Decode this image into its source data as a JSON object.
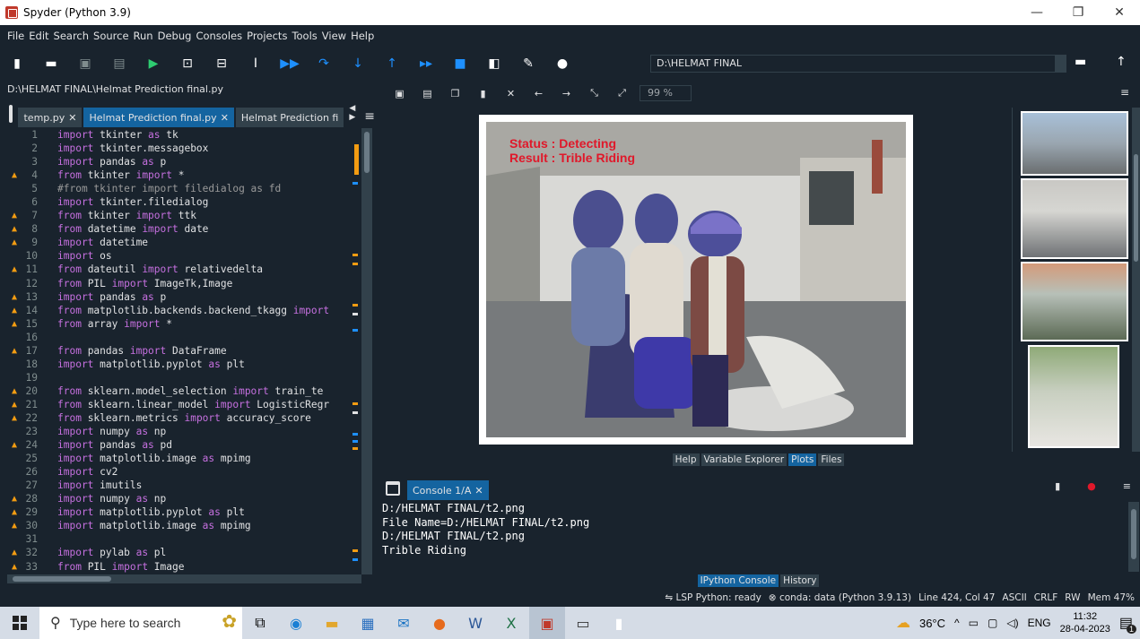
{
  "window": {
    "title": "Spyder (Python 3.9)"
  },
  "menu": [
    "File",
    "Edit",
    "Search",
    "Source",
    "Run",
    "Debug",
    "Consoles",
    "Projects",
    "Tools",
    "View",
    "Help"
  ],
  "toolbar": {
    "working_dir": "D:\\HELMAT FINAL"
  },
  "editor": {
    "file_path": "D:\\HELMAT FINAL\\Helmat Prediction final.py",
    "tabs": [
      {
        "label": "temp.py",
        "active": false
      },
      {
        "label": "Helmat Prediction final.py",
        "active": true
      },
      {
        "label": "Helmat Prediction fi",
        "active": false
      }
    ],
    "lines": [
      {
        "n": "1",
        "w": false,
        "t": "import tkinter as tk"
      },
      {
        "n": "2",
        "w": false,
        "t": "import tkinter.messagebox"
      },
      {
        "n": "3",
        "w": false,
        "t": "import pandas as p"
      },
      {
        "n": "4",
        "w": true,
        "t": "from tkinter import *"
      },
      {
        "n": "5",
        "w": false,
        "t": "#from tkinter import filedialog as fd"
      },
      {
        "n": "6",
        "w": false,
        "t": "import tkinter.filedialog"
      },
      {
        "n": "7",
        "w": true,
        "t": "from tkinter import ttk"
      },
      {
        "n": "8",
        "w": true,
        "t": "from datetime import date"
      },
      {
        "n": "9",
        "w": true,
        "t": "import datetime"
      },
      {
        "n": "10",
        "w": false,
        "t": "import os"
      },
      {
        "n": "11",
        "w": true,
        "t": "from dateutil import relativedelta"
      },
      {
        "n": "12",
        "w": false,
        "t": "from PIL import ImageTk,Image"
      },
      {
        "n": "13",
        "w": true,
        "t": "import pandas as p"
      },
      {
        "n": "14",
        "w": true,
        "t": "from matplotlib.backends.backend_tkagg import"
      },
      {
        "n": "15",
        "w": true,
        "t": "from array import *"
      },
      {
        "n": "16",
        "w": false,
        "t": ""
      },
      {
        "n": "17",
        "w": true,
        "t": "from pandas import DataFrame"
      },
      {
        "n": "18",
        "w": false,
        "t": "import matplotlib.pyplot as plt"
      },
      {
        "n": "19",
        "w": false,
        "t": ""
      },
      {
        "n": "20",
        "w": true,
        "t": "from sklearn.model_selection import train_te"
      },
      {
        "n": "21",
        "w": true,
        "t": "from sklearn.linear_model import LogisticRegr"
      },
      {
        "n": "22",
        "w": true,
        "t": "from sklearn.metrics import accuracy_score"
      },
      {
        "n": "23",
        "w": false,
        "t": "import numpy as np"
      },
      {
        "n": "24",
        "w": true,
        "t": "import pandas as pd"
      },
      {
        "n": "25",
        "w": false,
        "t": "import matplotlib.image as mpimg"
      },
      {
        "n": "26",
        "w": false,
        "t": "import cv2"
      },
      {
        "n": "27",
        "w": false,
        "t": "import imutils"
      },
      {
        "n": "28",
        "w": true,
        "t": "import numpy as np"
      },
      {
        "n": "29",
        "w": true,
        "t": "import matplotlib.pyplot as plt"
      },
      {
        "n": "30",
        "w": true,
        "t": "import matplotlib.image as mpimg"
      },
      {
        "n": "31",
        "w": false,
        "t": ""
      },
      {
        "n": "32",
        "w": true,
        "t": "import pylab as pl"
      },
      {
        "n": "33",
        "w": true,
        "t": "from PIL import Image"
      }
    ]
  },
  "plots": {
    "zoom": "99 %",
    "status_line1": "Status : Detecting",
    "status_line2": "Result : Trible Riding"
  },
  "pane_tabs": [
    {
      "label": "Help",
      "active": false
    },
    {
      "label": "Variable Explorer",
      "active": false
    },
    {
      "label": "Plots",
      "active": true
    },
    {
      "label": "Files",
      "active": false
    }
  ],
  "console": {
    "tab_label": "Console 1/A",
    "lines": [
      "D:/HELMAT FINAL/t2.png",
      "File Name=D:/HELMAT FINAL/t2.png",
      "D:/HELMAT FINAL/t2.png",
      "Trible Riding"
    ],
    "bottom_tabs": [
      {
        "label": "IPython Console",
        "active": true
      },
      {
        "label": "History",
        "active": false
      }
    ]
  },
  "statusbar": {
    "lsp": "LSP Python: ready",
    "conda": "conda: data (Python 3.9.13)",
    "position": "Line 424, Col 47",
    "encoding": "ASCII",
    "eol": "CRLF",
    "mode": "RW",
    "mem": "Mem 47%"
  },
  "taskbar": {
    "search_placeholder": "Type here to search",
    "temperature": "36°C",
    "language": "ENG",
    "time": "11:32",
    "date": "28-04-2023",
    "notifications": "1"
  }
}
